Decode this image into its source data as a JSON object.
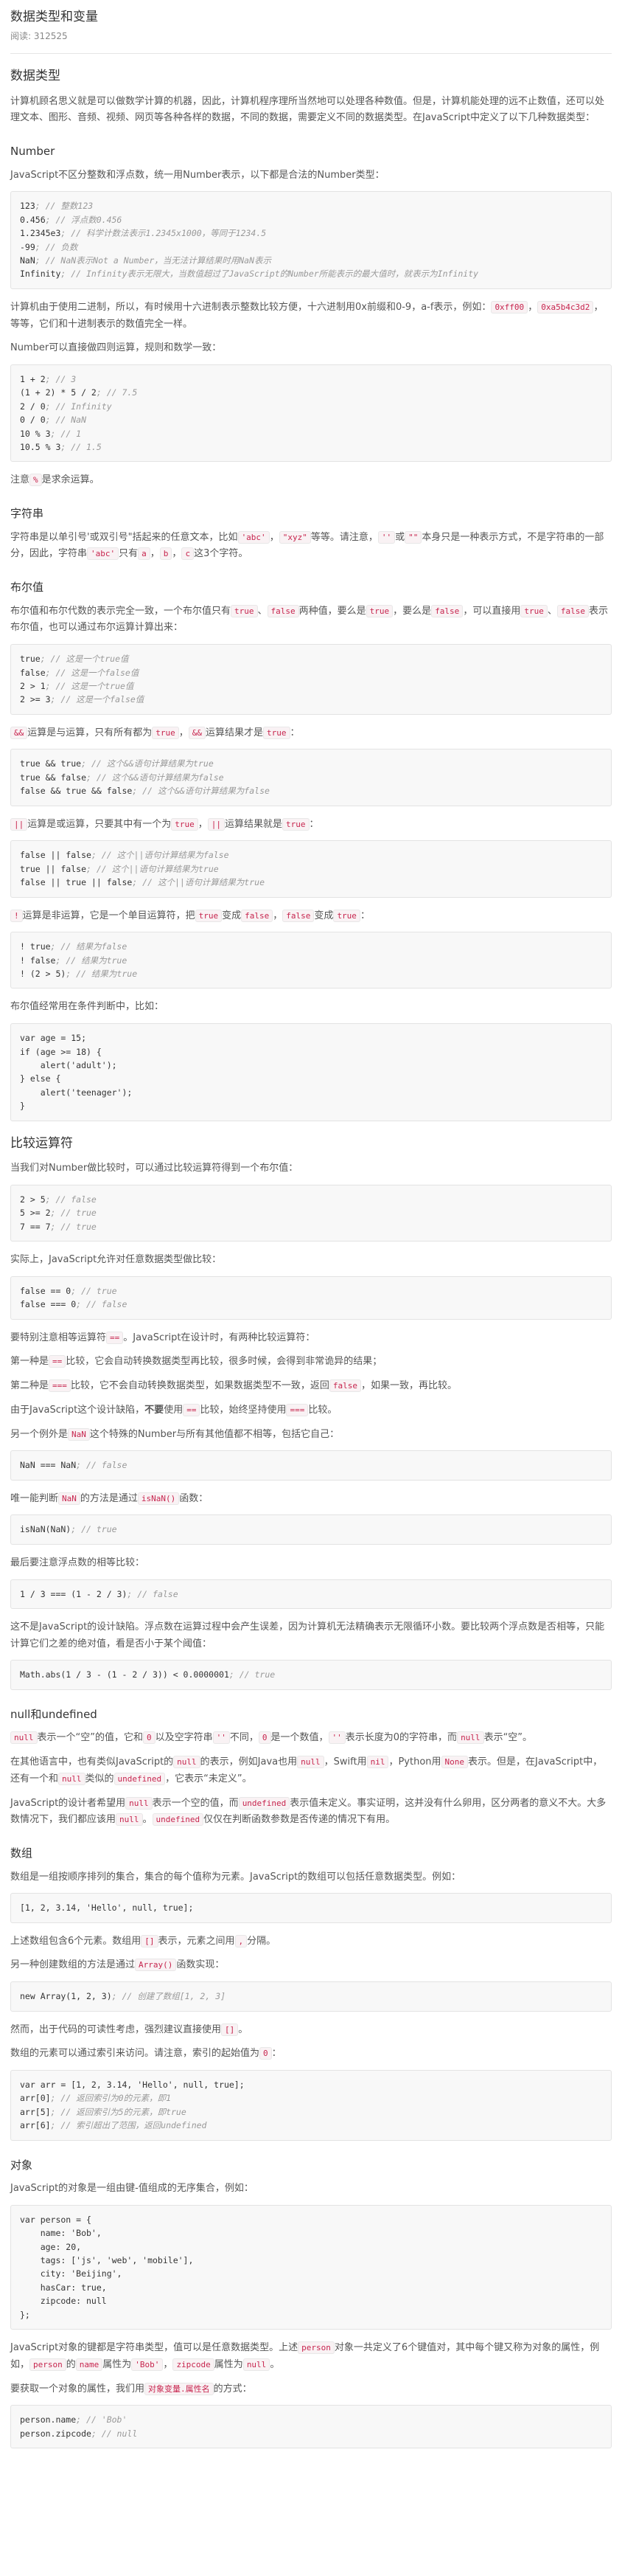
{
  "header": {
    "title": "数据类型和变量",
    "views": "阅读: 312525"
  },
  "sections": {
    "types_heading": "数据类型",
    "types_intro": "计算机顾名思义就是可以做数学计算的机器，因此，计算机程序理所当然地可以处理各种数值。但是，计算机能处理的远不止数值，还可以处理文本、图形、音频、视频、网页等各种各样的数据，不同的数据，需要定义不同的数据类型。在JavaScript中定义了以下几种数据类型：",
    "number_heading": "Number",
    "number_intro": "JavaScript不区分整数和浮点数，统一用Number表示，以下都是合法的Number类型：",
    "number_code": [
      [
        "123",
        "; // 整数123"
      ],
      [
        "0.456",
        "; // 浮点数0.456"
      ],
      [
        "1.2345e3",
        "; // 科学计数法表示1.2345x1000，等同于1234.5"
      ],
      [
        "-99",
        "; // 负数"
      ],
      [
        "NaN",
        "; // NaN表示Not a Number，当无法计算结果时用NaN表示"
      ],
      [
        "Infinity",
        "; // Infinity表示无限大，当数值超过了JavaScript的Number所能表示的最大值时，就表示为Infinity"
      ]
    ],
    "hex_p1": "计算机由于使用二进制，所以，有时候用十六进制表示整数比较方便，十六进制用0x前缀和0-9，a-f表示，例如：",
    "hex_c1": "0xff00",
    "hex_sep": "，",
    "hex_c2": "0xa5b4c3d2",
    "hex_p2": "，等等，它们和十进制表示的数值完全一样。",
    "arith_intro": "Number可以直接做四则运算，规则和数学一致：",
    "arith_code": [
      [
        "1 + 2",
        "; // 3"
      ],
      [
        "(1 + 2) * 5 / 2",
        "; // 7.5"
      ],
      [
        "2 / 0",
        "; // Infinity"
      ],
      [
        "0 / 0",
        "; // NaN"
      ],
      [
        "10 % 3",
        "; // 1"
      ],
      [
        "10.5 % 3",
        "; // 1.5"
      ]
    ],
    "mod_p1": "注意",
    "mod_c": "%",
    "mod_p2": "是求余运算。",
    "string_heading": "字符串",
    "string_p1": "字符串是以单引号'或双引号\"括起来的任意文本，比如",
    "string_c1": "'abc'",
    "string_p2": "，",
    "string_c2": "\"xyz\"",
    "string_p3": "等等。请注意，",
    "string_c3": "''",
    "string_p4": "或",
    "string_c4": "\"\"",
    "string_p5": "本身只是一种表示方式，不是字符串的一部分，因此，字符串",
    "string_c5": "'abc'",
    "string_p6": "只有",
    "string_c6": "a",
    "string_p7": "，",
    "string_c7": "b",
    "string_p8": "，",
    "string_c8": "c",
    "string_p9": "这3个字符。",
    "bool_heading": "布尔值",
    "bool_p1": "布尔值和布尔代数的表示完全一致，一个布尔值只有",
    "bool_c1": "true",
    "bool_p2": "、",
    "bool_c2": "false",
    "bool_p3": "两种值，要么是",
    "bool_c3": "true",
    "bool_p4": "，要么是",
    "bool_c4": "false",
    "bool_p5": "，可以直接用",
    "bool_c5": "true",
    "bool_p6": "、",
    "bool_c6": "false",
    "bool_p7": "表示布尔值，也可以通过布尔运算计算出来：",
    "bool_code": [
      [
        "true",
        "; // 这是一个true值"
      ],
      [
        "false",
        "; // 这是一个false值"
      ],
      [
        "2 > 1",
        "; // 这是一个true值"
      ],
      [
        "2 >= 3",
        "; // 这是一个false值"
      ]
    ],
    "and_c1": "&&",
    "and_p1": "运算是与运算，只有所有都为",
    "and_c2": "true",
    "and_p2": "，",
    "and_c3": "&&",
    "and_p3": "运算结果才是",
    "and_c4": "true",
    "and_p4": "：",
    "and_code": [
      [
        "true && true",
        "; // 这个&&语句计算结果为true"
      ],
      [
        "true && false",
        "; // 这个&&语句计算结果为false"
      ],
      [
        "false && true && false",
        "; // 这个&&语句计算结果为false"
      ]
    ],
    "or_c1": "||",
    "or_p1": "运算是或运算，只要其中有一个为",
    "or_c2": "true",
    "or_p2": "，",
    "or_c3": "||",
    "or_p3": "运算结果就是",
    "or_c4": "true",
    "or_p4": "：",
    "or_code": [
      [
        "false || false",
        "; // 这个||语句计算结果为false"
      ],
      [
        "true || false",
        "; // 这个||语句计算结果为true"
      ],
      [
        "false || true || false",
        "; // 这个||语句计算结果为true"
      ]
    ],
    "not_c1": "!",
    "not_p1": "运算是非运算，它是一个单目运算符，把",
    "not_c2": "true",
    "not_p2": "变成",
    "not_c3": "false",
    "not_p3": "，",
    "not_c4": "false",
    "not_p4": "变成",
    "not_c5": "true",
    "not_p5": "：",
    "not_code": [
      [
        "! true",
        "; // 结果为false"
      ],
      [
        "! false",
        "; // 结果为true"
      ],
      [
        "! (2 > 5)",
        "; // 结果为true"
      ]
    ],
    "cond_intro": "布尔值经常用在条件判断中，比如：",
    "cond_code": "var age = 15;\nif (age >= 18) {\n    alert('adult');\n} else {\n    alert('teenager');\n}",
    "cmp_heading": "比较运算符",
    "cmp_intro": "当我们对Number做比较时，可以通过比较运算符得到一个布尔值：",
    "cmp_code": [
      [
        "2 > 5",
        "; // false"
      ],
      [
        "5 >= 2",
        "; // true"
      ],
      [
        "7 == 7",
        "; // true"
      ]
    ],
    "cmp_any": "实际上，JavaScript允许对任意数据类型做比较：",
    "cmp_any_code": [
      [
        "false == 0",
        "; // true"
      ],
      [
        "false === 0",
        "; // false"
      ]
    ],
    "eq_p1": "要特别注意相等运算符",
    "eq_c1": "==",
    "eq_p2": "。JavaScript在设计时，有两种比较运算符：",
    "eq_first_p1": "第一种是",
    "eq_first_c": "==",
    "eq_first_p2": "比较，它会自动转换数据类型再比较，很多时候，会得到非常诡异的结果；",
    "eq_second_p1": "第二种是",
    "eq_second_c": "===",
    "eq_second_p2": "比较，它不会自动转换数据类型，如果数据类型不一致，返回",
    "eq_second_c2": "false",
    "eq_second_p3": "，如果一致，再比较。",
    "eq_defect_p1": "由于JavaScript这个设计缺陷，",
    "eq_defect_b1": "不要",
    "eq_defect_p2": "使用",
    "eq_defect_c1": "==",
    "eq_defect_p3": "比较，始终坚持使用",
    "eq_defect_c2": "===",
    "eq_defect_p4": "比较。",
    "nan_p1": "另一个例外是",
    "nan_c1": "NaN",
    "nan_p2": "这个特殊的Number与所有其他值都不相等，包括它自己：",
    "nan_code": [
      "NaN === NaN",
      "; // false"
    ],
    "isnan_p1": "唯一能判断",
    "isnan_c1": "NaN",
    "isnan_p2": "的方法是通过",
    "isnan_c2": "isNaN()",
    "isnan_p3": "函数：",
    "isnan_code": [
      "isNaN(NaN)",
      "; // true"
    ],
    "float_intro": "最后要注意浮点数的相等比较：",
    "float_code": [
      "1 / 3 === (1 - 2 / 3)",
      "; // false"
    ],
    "float_p": "这不是JavaScript的设计缺陷。浮点数在运算过程中会产生误差，因为计算机无法精确表示无限循环小数。要比较两个浮点数是否相等，只能计算它们之差的绝对值，看是否小于某个阈值：",
    "float_abs_code": [
      "Math.abs(1 / 3 - (1 - 2 / 3)) < 0.0000001",
      "; // true"
    ],
    "null_heading": "null和undefined",
    "null_p1_c1": "null",
    "null_p1_a": "表示一个“空”的值，它和",
    "null_p1_c2": "0",
    "null_p1_b": "以及空字符串",
    "null_p1_c3": "''",
    "null_p1_c": "不同，",
    "null_p1_c4": "0",
    "null_p1_d": "是一个数值，",
    "null_p1_c5": "''",
    "null_p1_e": "表示长度为0的字符串，而",
    "null_p1_c6": "null",
    "null_p1_f": "表示“空”。",
    "null_p2_a": "在其他语言中，也有类似JavaScript的",
    "null_p2_c1": "null",
    "null_p2_b": "的表示，例如Java也用",
    "null_p2_c2": "null",
    "null_p2_c": "，Swift用",
    "null_p2_c3": "nil",
    "null_p2_d": "，Python用",
    "null_p2_c4": "None",
    "null_p2_e": "表示。但是，在JavaScript中，还有一个和",
    "null_p2_c5": "null",
    "null_p2_f": "类似的",
    "null_p2_c6": "undefined",
    "null_p2_g": "，它表示“未定义”。",
    "null_p3_a": "JavaScript的设计者希望用",
    "null_p3_c1": "null",
    "null_p3_b": "表示一个空的值，而",
    "null_p3_c2": "undefined",
    "null_p3_c": "表示值未定义。事实证明，这并没有什么卵用，区分两者的意义不大。大多数情况下，我们都应该用",
    "null_p3_c3": "null",
    "null_p3_d": "。",
    "null_p3_c4": "undefined",
    "null_p3_e": "仅仅在判断函数参数是否传递的情况下有用。",
    "array_heading": "数组",
    "array_intro": "数组是一组按顺序排列的集合，集合的每个值称为元素。JavaScript的数组可以包括任意数据类型。例如：",
    "array_code": "[1, 2, 3.14, 'Hello', null, true];",
    "array_p1": "上述数组包含6个元素。数组用",
    "array_c1": "[]",
    "array_p2": "表示，元素之间用",
    "array_c2": ",",
    "array_p3": "分隔。",
    "array_new_p1": "另一种创建数组的方法是通过",
    "array_new_c": "Array()",
    "array_new_p2": "函数实现：",
    "array_new_code": [
      "new Array(1, 2, 3)",
      "; // 创建了数组[1, 2, 3]"
    ],
    "array_read_p1": "然而，出于代码的可读性考虑，强烈建议直接使用",
    "array_read_c": "[]",
    "array_read_p2": "。",
    "array_idx_p1": "数组的元素可以通过索引来访问。请注意，索引的起始值为",
    "array_idx_c": "0",
    "array_idx_p2": "：",
    "array_idx_code": [
      [
        "var arr = [1, 2, 3.14, 'Hello', null, true];",
        ""
      ],
      [
        "arr[0]",
        "; // 返回索引为0的元素，即1"
      ],
      [
        "arr[5]",
        "; // 返回索引为5的元素，即true"
      ],
      [
        "arr[6]",
        "; // 索引超出了范围，返回undefined"
      ]
    ],
    "obj_heading": "对象",
    "obj_intro": "JavaScript的对象是一组由键-值组成的无序集合，例如：",
    "obj_code": "var person = {\n    name: 'Bob',\n    age: 20,\n    tags: ['js', 'web', 'mobile'],\n    city: 'Beijing',\n    hasCar: true,\n    zipcode: null\n};",
    "obj_p_a": "JavaScript对象的键都是字符串类型，值可以是任意数据类型。上述",
    "obj_p_c1": "person",
    "obj_p_b": "对象一共定义了6个键值对，其中每个键又称为对象的属性，例如，",
    "obj_p_c2": "person",
    "obj_p_c": "的",
    "obj_p_c3": "name",
    "obj_p_d": "属性为",
    "obj_p_c4": "'Bob'",
    "obj_p_e": "，",
    "obj_p_c5": "zipcode",
    "obj_p_f": "属性为",
    "obj_p_c6": "null",
    "obj_p_g": "。",
    "obj_get_p1": "要获取一个对象的属性，我们用",
    "obj_get_c": "对象变量.属性名",
    "obj_get_p2": "的方式：",
    "obj_get_code": [
      [
        "person.name",
        "; // 'Bob'"
      ],
      [
        "person.zipcode",
        "; // null"
      ]
    ]
  }
}
